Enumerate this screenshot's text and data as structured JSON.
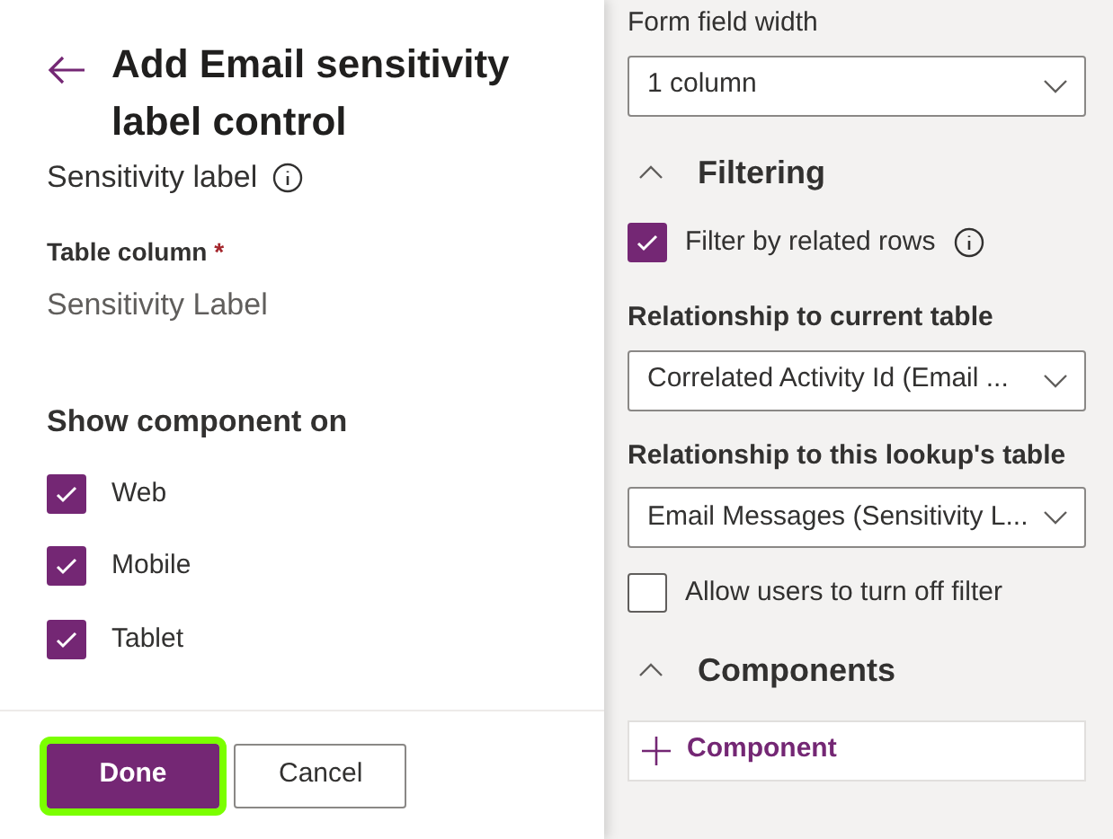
{
  "panel": {
    "title": "Add Email sensitivity label control",
    "section_label": "Sensitivity label",
    "table_column": {
      "label": "Table column",
      "required_mark": "*",
      "value": "Sensitivity Label"
    },
    "show_on": {
      "label": "Show component on",
      "options": [
        {
          "label": "Web",
          "checked": true
        },
        {
          "label": "Mobile",
          "checked": true
        },
        {
          "label": "Tablet",
          "checked": true
        }
      ]
    },
    "buttons": [
      {
        "label": "Done",
        "kind": "primary",
        "highlighted": true
      },
      {
        "label": "Cancel",
        "kind": "secondary",
        "highlighted": false
      }
    ]
  },
  "properties": {
    "form_field_width": {
      "label": "Form field width",
      "value": "1 column"
    },
    "filtering": {
      "title": "Filtering",
      "expanded": true,
      "filter_by_related": {
        "label": "Filter by related rows",
        "checked": true
      },
      "current_table": {
        "label": "Relationship to current table",
        "value": "Correlated Activity Id (Email ..."
      },
      "lookup_table": {
        "label": "Relationship to this lookup's table",
        "value": "Email Messages (Sensitivity L..."
      },
      "allow_off": {
        "label": "Allow users to turn off filter",
        "checked": false
      }
    },
    "components": {
      "title": "Components",
      "expanded": true,
      "add_button": "Component"
    }
  }
}
